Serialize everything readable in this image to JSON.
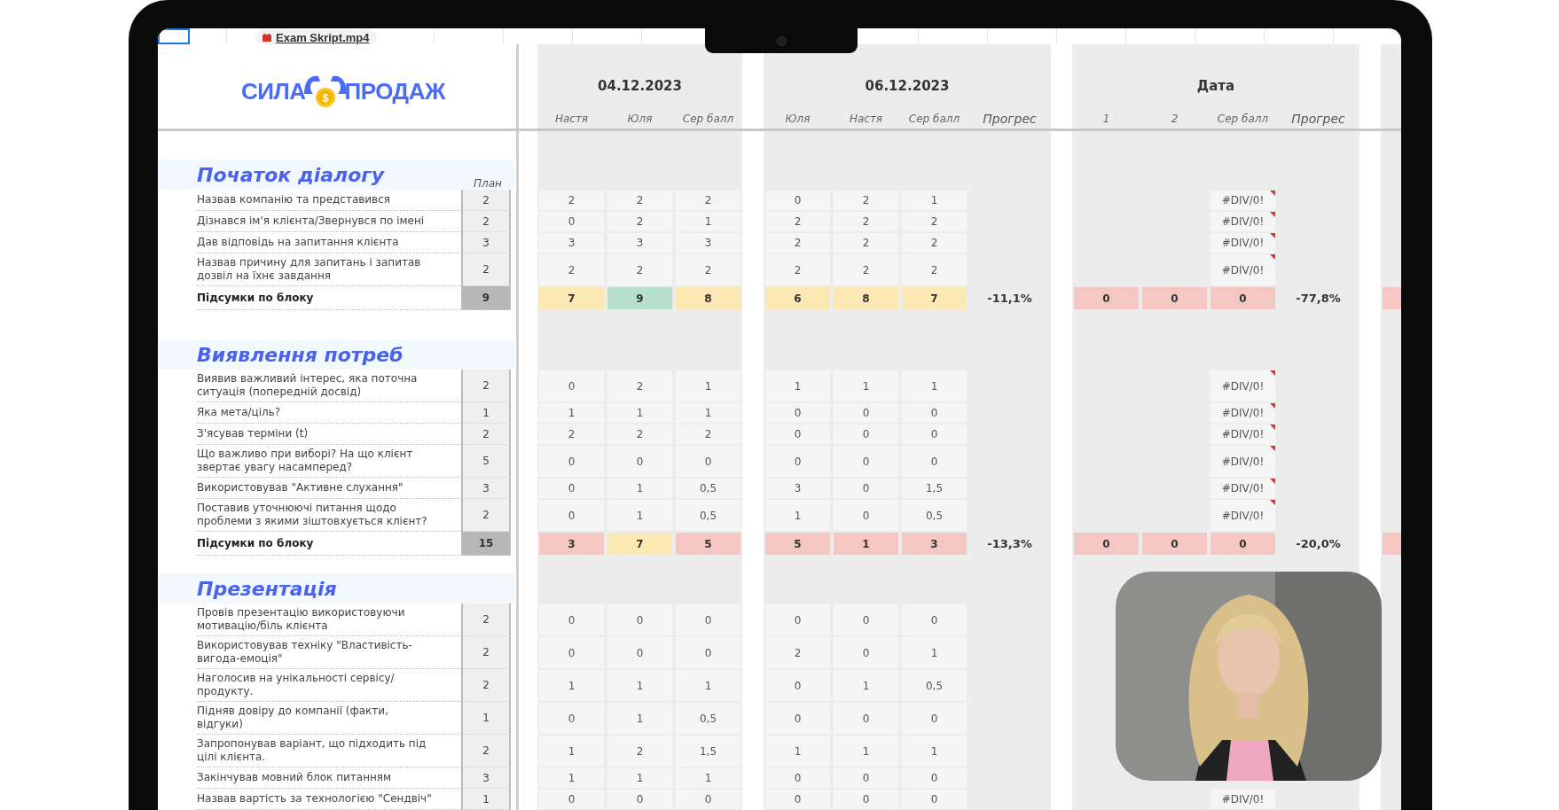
{
  "file_chip": {
    "name": "Exam Skript.mp4"
  },
  "logo": {
    "left": "СИЛА",
    "coin": "$",
    "right": "ПРОДАЖ"
  },
  "blocks": [
    {
      "kind": "scores",
      "date": "04.12.2023",
      "columns": [
        "Настя",
        "Юля",
        "Сер балл"
      ]
    },
    {
      "kind": "progress",
      "date": "06.12.2023",
      "columns": [
        "Юля",
        "Настя",
        "Сер балл"
      ],
      "progress_label": "Прогрес"
    },
    {
      "kind": "progress",
      "date": "Дата",
      "columns": [
        "1",
        "2",
        "Сер балл"
      ],
      "progress_label": "Прогрес"
    },
    {
      "kind": "cut"
    }
  ],
  "sections": [
    {
      "title": "Початок діалогу",
      "plan_label": "План",
      "rows": [
        {
          "label": "Назвав компанію та представився",
          "plan": "2",
          "blocks": [
            [
              "2",
              "2",
              "2"
            ],
            [
              "0",
              "2",
              "1"
            ]
          ],
          "error": {
            "text": "#DIV/0!",
            "note": true
          }
        },
        {
          "label": "Дізнався ім'я клієнта/Звернувся по імені",
          "plan": "2",
          "blocks": [
            [
              "0",
              "2",
              "1"
            ],
            [
              "2",
              "2",
              "2"
            ]
          ],
          "error": {
            "text": "#DIV/0!",
            "note": true
          }
        },
        {
          "label": "Дав відповідь на запитання клієнта",
          "plan": "3",
          "blocks": [
            [
              "3",
              "3",
              "3"
            ],
            [
              "2",
              "2",
              "2"
            ]
          ],
          "error": {
            "text": "#DIV/0!",
            "note": true
          }
        },
        {
          "label": "Назвав причину для запитань і запитав дозвіл на їхнє завдання",
          "plan": "2",
          "blocks": [
            [
              "2",
              "2",
              "2"
            ],
            [
              "2",
              "2",
              "2"
            ]
          ],
          "error": {
            "text": "#DIV/0!",
            "note": true
          }
        }
      ],
      "total": {
        "label": "Підсумки по блоку",
        "plan": "9",
        "blocks": [
          {
            "cells": [
              {
                "value": "7",
                "color": "#fce8b2"
              },
              {
                "value": "9",
                "color": "#b7e1cd"
              },
              {
                "value": "8",
                "color": "#fce8b2"
              }
            ]
          },
          {
            "cells": [
              {
                "value": "6",
                "color": "#fce8b2"
              },
              {
                "value": "8",
                "color": "#fce8b2"
              },
              {
                "value": "7",
                "color": "#fce8b2"
              }
            ],
            "progress": "-11,1%"
          },
          {
            "cells": [
              {
                "value": "0",
                "color": "#f4c7c3"
              },
              {
                "value": "0",
                "color": "#f4c7c3"
              },
              {
                "value": "0",
                "color": "#f4c7c3"
              }
            ],
            "progress": "-77,8%"
          },
          {
            "cells": [
              {
                "color": "#f4c7c3"
              }
            ]
          }
        ]
      }
    },
    {
      "title": "Виявлення потреб",
      "rows": [
        {
          "label": "Виявив важливий інтерес, яка поточна ситуація (попередній досвід)",
          "plan": "2",
          "blocks": [
            [
              "0",
              "2",
              "1"
            ],
            [
              "1",
              "1",
              "1"
            ]
          ],
          "error": {
            "text": "#DIV/0!",
            "note": true
          }
        },
        {
          "label": "Яка мета/ціль?",
          "plan": "1",
          "blocks": [
            [
              "1",
              "1",
              "1"
            ],
            [
              "0",
              "0",
              "0"
            ]
          ],
          "error": {
            "text": "#DIV/0!",
            "note": true
          }
        },
        {
          "label": "З'ясував терміни (t)",
          "plan": "2",
          "blocks": [
            [
              "2",
              "2",
              "2"
            ],
            [
              "0",
              "0",
              "0"
            ]
          ],
          "error": {
            "text": "#DIV/0!",
            "note": true
          }
        },
        {
          "label": "Що важливо при виборі? На що клієнт звертає увагу насамперед?",
          "plan": "5",
          "blocks": [
            [
              "0",
              "0",
              "0"
            ],
            [
              "0",
              "0",
              "0"
            ]
          ],
          "error": {
            "text": "#DIV/0!",
            "note": true
          }
        },
        {
          "label": "Використовував \"Активне слухання\"",
          "plan": "3",
          "blocks": [
            [
              "0",
              "1",
              "0,5"
            ],
            [
              "3",
              "0",
              "1,5"
            ]
          ],
          "error": {
            "text": "#DIV/0!",
            "note": true
          }
        },
        {
          "label": "Поставив уточнюючі питання щодо проблеми з якими зіштовхується клієнт?",
          "plan": "2",
          "blocks": [
            [
              "0",
              "1",
              "0,5"
            ],
            [
              "1",
              "0",
              "0,5"
            ]
          ],
          "error": {
            "text": "#DIV/0!",
            "note": true
          }
        }
      ],
      "total": {
        "label": "Підсумки по блоку",
        "plan": "15",
        "blocks": [
          {
            "cells": [
              {
                "value": "3",
                "color": "#f4c7c3"
              },
              {
                "value": "7",
                "color": "#fce8b2"
              },
              {
                "value": "5",
                "color": "#f4c7c3"
              }
            ]
          },
          {
            "cells": [
              {
                "value": "5",
                "color": "#f4c7c3"
              },
              {
                "value": "1",
                "color": "#f4c7c3"
              },
              {
                "value": "3",
                "color": "#f4c7c3"
              }
            ],
            "progress": "-13,3%"
          },
          {
            "cells": [
              {
                "value": "0",
                "color": "#f4c7c3"
              },
              {
                "value": "0",
                "color": "#f4c7c3"
              },
              {
                "value": "0",
                "color": "#f4c7c3"
              }
            ],
            "progress": "-20,0%"
          },
          {
            "cells": [
              {
                "color": "#f4c7c3"
              }
            ]
          }
        ]
      }
    },
    {
      "title": "Презентація",
      "rows": [
        {
          "label": "Провів презентацію використовуючи мотивацію/біль клієнта",
          "plan": "2",
          "blocks": [
            [
              "0",
              "0",
              "0"
            ],
            [
              "0",
              "0",
              "0"
            ]
          ]
        },
        {
          "label": "Використовував техніку \"Властивість-вигода-емоція\"",
          "plan": "2",
          "blocks": [
            [
              "0",
              "0",
              "0"
            ],
            [
              "2",
              "0",
              "1"
            ]
          ]
        },
        {
          "label": "Наголосив на унікальності сервісу/продукту.",
          "plan": "2",
          "blocks": [
            [
              "1",
              "1",
              "1"
            ],
            [
              "0",
              "1",
              "0,5"
            ]
          ]
        },
        {
          "label": "Підняв довіру до компанії (факти, відгуки)",
          "plan": "1",
          "blocks": [
            [
              "0",
              "1",
              "0,5"
            ],
            [
              "0",
              "0",
              "0"
            ]
          ]
        },
        {
          "label": "Запропонував варіант, що підходить під цілі клієнта.",
          "plan": "2",
          "blocks": [
            [
              "1",
              "2",
              "1,5"
            ],
            [
              "1",
              "1",
              "1"
            ]
          ]
        },
        {
          "label": "Закінчував мовний блок питанням",
          "plan": "3",
          "blocks": [
            [
              "1",
              "1",
              "1"
            ],
            [
              "0",
              "0",
              "0"
            ]
          ]
        },
        {
          "label": "Назвав вартість за технологією \"Сендвіч\"",
          "plan": "1",
          "blocks": [
            [
              "0",
              "0",
              "0"
            ],
            [
              "0",
              "0",
              "0"
            ]
          ],
          "error": {
            "text": "#DIV/0!",
            "note": false
          }
        }
      ]
    }
  ]
}
